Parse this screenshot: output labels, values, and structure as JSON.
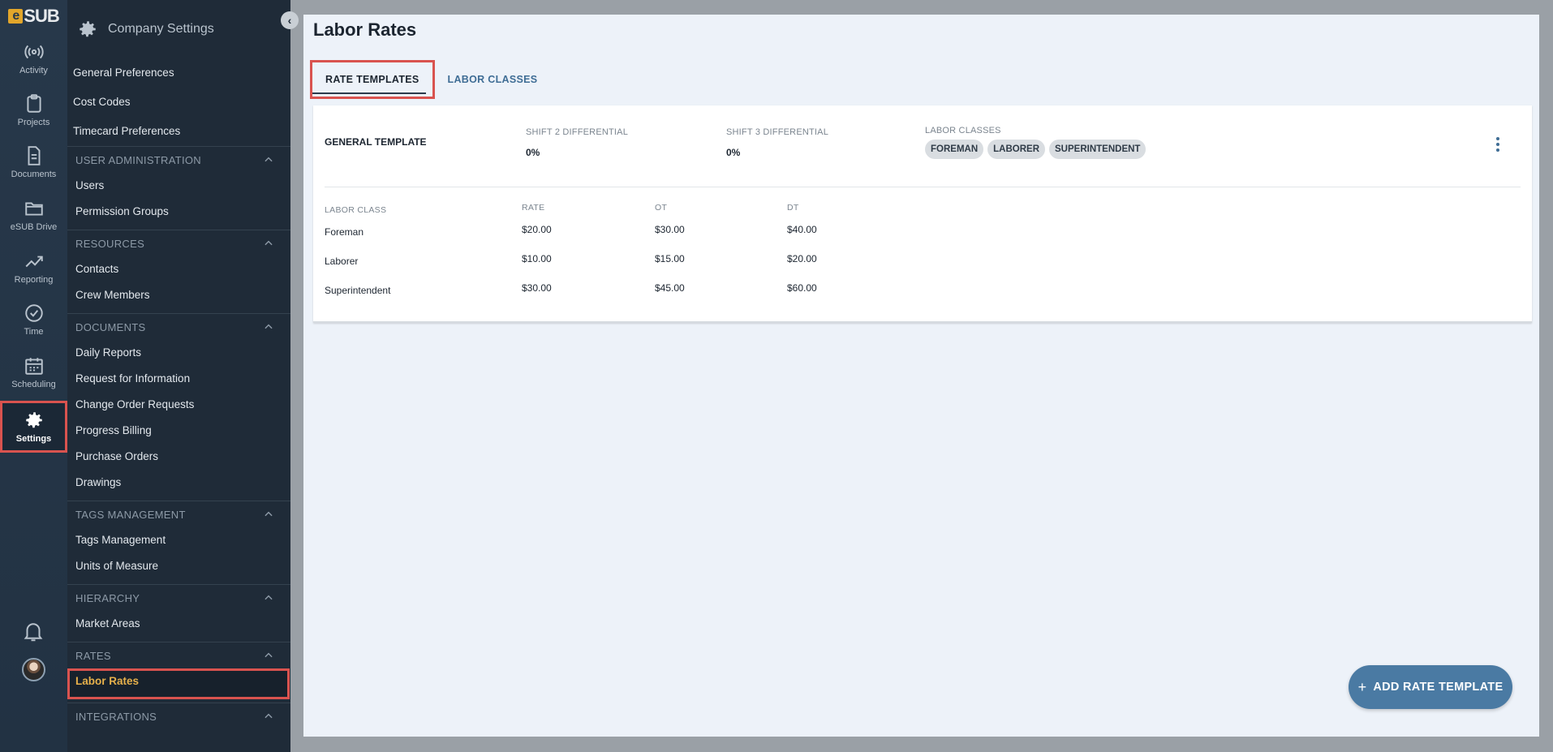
{
  "brand": {
    "logo_text": "SUB",
    "logo_mark": "e"
  },
  "rail": {
    "items": [
      {
        "label": "Activity",
        "icon": "activity-icon"
      },
      {
        "label": "Projects",
        "icon": "clipboard-icon"
      },
      {
        "label": "Documents",
        "icon": "document-icon"
      },
      {
        "label": "eSUB Drive",
        "icon": "folder-icon"
      },
      {
        "label": "Reporting",
        "icon": "chart-icon"
      },
      {
        "label": "Time",
        "icon": "clock-icon"
      },
      {
        "label": "Scheduling",
        "icon": "calendar-icon"
      },
      {
        "label": "Settings",
        "icon": "gear-icon"
      }
    ]
  },
  "sidebar": {
    "title": "Company Settings",
    "top_links": [
      "General Preferences",
      "Cost Codes",
      "Timecard Preferences"
    ],
    "sections": [
      {
        "title": "USER ADMINISTRATION",
        "items": [
          "Users",
          "Permission Groups"
        ]
      },
      {
        "title": "RESOURCES",
        "items": [
          "Contacts",
          "Crew Members"
        ]
      },
      {
        "title": "DOCUMENTS",
        "items": [
          "Daily Reports",
          "Request for Information",
          "Change Order Requests",
          "Progress Billing",
          "Purchase Orders",
          "Drawings"
        ]
      },
      {
        "title": "TAGS MANAGEMENT",
        "items": [
          "Tags Management",
          "Units of Measure"
        ]
      },
      {
        "title": "HIERARCHY",
        "items": [
          "Market Areas"
        ]
      },
      {
        "title": "RATES",
        "items": [
          "Labor Rates"
        ]
      },
      {
        "title": "INTEGRATIONS",
        "items": []
      }
    ]
  },
  "page": {
    "title": "Labor Rates",
    "tabs": [
      {
        "label": "RATE TEMPLATES",
        "active": true
      },
      {
        "label": "LABOR CLASSES",
        "active": false
      }
    ]
  },
  "template": {
    "name": "GENERAL TEMPLATE",
    "shift2_label": "SHIFT 2 DIFFERENTIAL",
    "shift2_value": "0%",
    "shift3_label": "SHIFT 3 DIFFERENTIAL",
    "shift3_value": "0%",
    "classes_label": "LABOR CLASSES",
    "classes": [
      "FOREMAN",
      "LABORER",
      "SUPERINTENDENT"
    ],
    "table": {
      "headers": [
        "LABOR CLASS",
        "RATE",
        "OT",
        "DT"
      ],
      "rows": [
        [
          "Foreman",
          "$20.00",
          "$30.00",
          "$40.00"
        ],
        [
          "Laborer",
          "$10.00",
          "$15.00",
          "$20.00"
        ],
        [
          "Superintendent",
          "$30.00",
          "$45.00",
          "$60.00"
        ]
      ]
    }
  },
  "fab": {
    "plus": "+",
    "label": "ADD RATE TEMPLATE"
  },
  "colors": {
    "accent": "#4a7aa3",
    "highlight": "#d9534f",
    "active_link": "#e6b04b"
  }
}
